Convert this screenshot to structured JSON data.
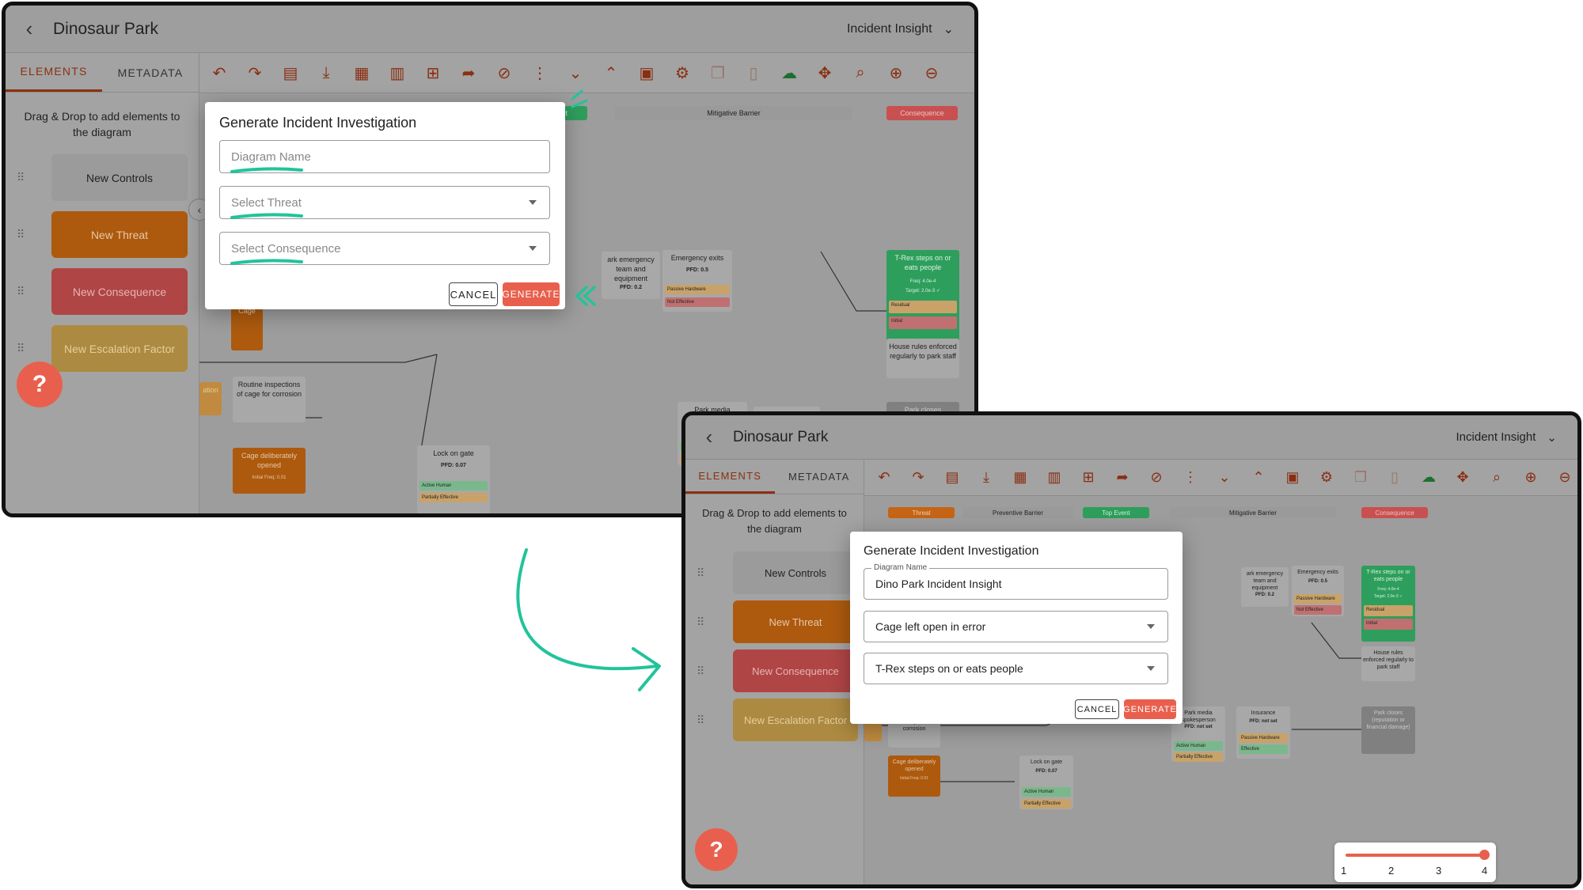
{
  "app": {
    "title": "Dinosaur Park",
    "menu_label": "Incident Insight"
  },
  "sidebar": {
    "tabs": [
      "ELEMENTS",
      "METADATA"
    ],
    "hint": "Drag & Drop to add elements to the diagram",
    "items": [
      "New Controls",
      "New Threat",
      "New Consequence",
      "New Escalation Factor"
    ]
  },
  "toolbar": {
    "icons": [
      "undo-icon",
      "redo-icon",
      "chart-icon",
      "download-icon",
      "table-icon",
      "sheet-icon",
      "add-note-icon",
      "forward-icon",
      "link-icon",
      "grid-icon",
      "expand-down-icon",
      "collapse-up-icon",
      "calculator-icon",
      "gear-icon",
      "copy-icon",
      "trash-icon",
      "cloud-check-icon",
      "move-icon",
      "search-icon",
      "zoom-in-icon",
      "zoom-out-icon"
    ]
  },
  "canvas": {
    "headers": [
      "Threat",
      "Preventive Barrier",
      "Top Event",
      "Mitigative Barrier",
      "Consequence"
    ],
    "nodes": {
      "cage": "Cage",
      "routine": "Routine inspections of cage for corrosion",
      "cage_opened": "Cage deliberately opened",
      "cage_opened_freq": "Initial Freq: 0.01",
      "lock": "Lock on gate",
      "lock_pfd": "PFD: 0.07",
      "active_human": "Active Human",
      "partially_effective": "Partially Effective",
      "park_emergency": "ark emergency team and equipment",
      "park_emergency_pfd": "PFD: 0.2",
      "emergency_exits": "Emergency exits",
      "emergency_exits_pfd": "PFD: 0.5",
      "passive_hardware": "Passive Hardware",
      "not_effective": "Not Effective",
      "trex": "T-Rex steps on or eats people",
      "trex_freq": "Freq: 4.0e-4",
      "trex_target": "Target: 2.0e-3 ✓",
      "trex_residual": "Residual",
      "trex_initial": "Initial",
      "house_rules": "House rules enforced regularly to park staff",
      "media": "Park media spokesperson",
      "media_pfd": "PFD: not set",
      "insurance": "Insurance",
      "insurance_pfd": "PFD: not set",
      "effective": "Effective",
      "park_closes": "Park closes",
      "park_closes_full": "Park closes (reputation or financial damage)",
      "entry": "ation"
    }
  },
  "dialog_before": {
    "title": "Generate Incident Investigation",
    "name_placeholder": "Diagram Name",
    "threat_placeholder": "Select Threat",
    "consequence_placeholder": "Select Consequence",
    "cancel": "CANCEL",
    "generate": "GENERATE"
  },
  "dialog_after": {
    "title": "Generate Incident Investigation",
    "name_label": "Diagram Name",
    "name_value": "Dino Park Incident Insight",
    "threat_value": "Cage left open in error",
    "consequence_value": "T-Rex steps on or eats people",
    "cancel": "CANCEL",
    "generate": "GENERATE"
  },
  "zoom_control": {
    "labels": [
      "1",
      "2",
      "3",
      "4"
    ],
    "value": 4
  },
  "colors": {
    "accent": "#e8604d",
    "highlight": "#22c39a",
    "threat": "#c46414",
    "consequence": "#c85050",
    "top_event": "#2e9e5c"
  }
}
